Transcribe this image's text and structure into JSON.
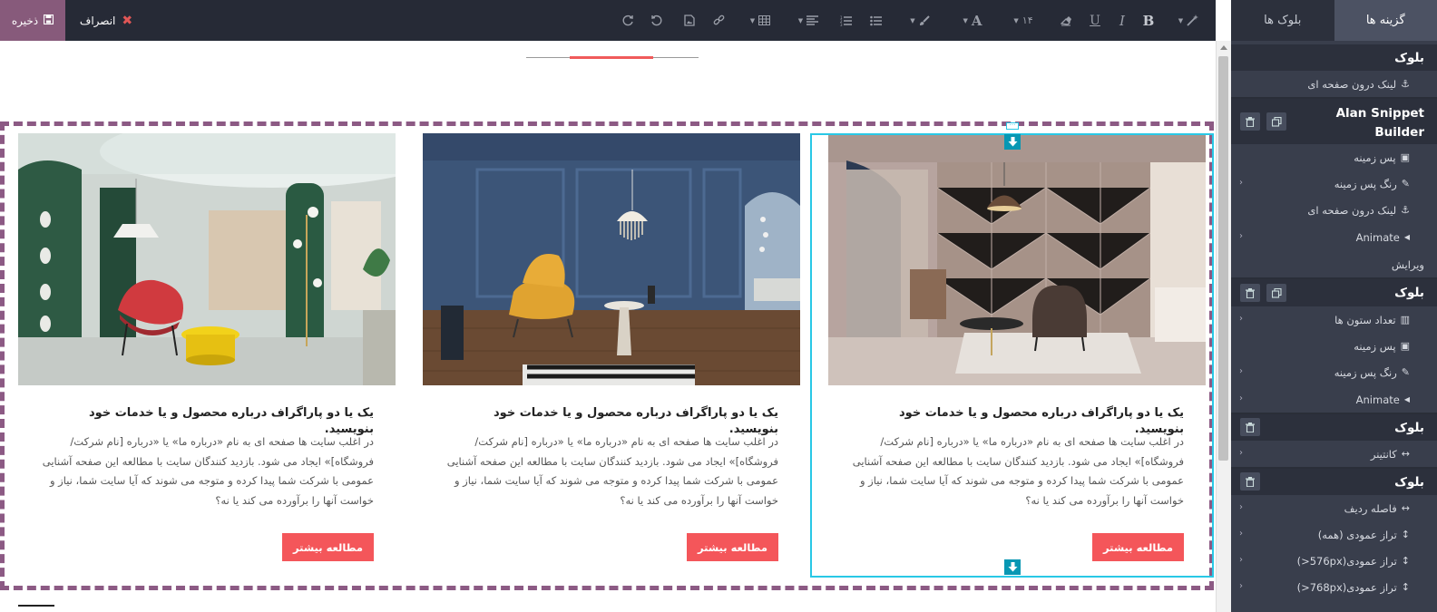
{
  "toolbar": {
    "save_label": "ذخیره",
    "discard_label": "انصراف",
    "font_size_label": "۱۴",
    "icons": [
      "magic-wand",
      "bold",
      "italic",
      "underline",
      "eraser",
      "font-size",
      "font-color",
      "paint-brush",
      "unordered-list",
      "ordered-list",
      "align",
      "table",
      "link",
      "image",
      "undo",
      "redo"
    ]
  },
  "sidebar": {
    "tabs": [
      {
        "label": "گزینه ها",
        "active": true
      },
      {
        "label": "بلوک ها",
        "active": false
      }
    ],
    "sections": {
      "s1_title": "بلوک",
      "s1_anchor": "لینک درون صفحه ای",
      "s2_title": "Alan Snippet Builder",
      "s2_background": "پس زمینه",
      "s2_bg_color": "رنگ پس زمینه",
      "s2_anchor": "لینک درون صفحه ای",
      "s2_animate": "Animate",
      "s2_edit": "ویرایش",
      "s3_title": "بلوک",
      "s3_columns": "تعداد ستون ها",
      "s3_background": "پس زمینه",
      "s3_bg_color": "رنگ پس زمینه",
      "s3_animate": "Animate",
      "s4_title": "بلوک",
      "s4_container": "کانتینر",
      "s5_title": "بلوک",
      "s5_row_gap": "فاصله ردیف",
      "s5_valign_all": "تراز عمودی (همه)",
      "s5_valign_576": "تراز عمودی(576px<)",
      "s5_valign_768": "تراز عمودی(768px<)"
    }
  },
  "cards": [
    {
      "title": "یک یا دو پاراگراف درباره محصول و یا خدمات خود بنویسید.",
      "description": "در اغلب سایت ها صفحه ای به نام «درباره ما» یا «درباره [نام شرکت/فروشگاه]» ایجاد می شود. بازدید کنندگان سایت با مطالعه این صفحه آشنایی عمومی با شرکت شما پیدا کرده و متوجه می شوند که آیا سایت شما، نیاز و خواست آنها را برآورده می کند یا نه؟",
      "button": "مطالعه بیشتر"
    },
    {
      "title": "یک یا دو پاراگراف درباره محصول و یا خدمات خود بنویسید.",
      "description": "در اغلب سایت ها صفحه ای به نام «درباره ما» یا «درباره [نام شرکت/فروشگاه]» ایجاد می شود. بازدید کنندگان سایت با مطالعه این صفحه آشنایی عمومی با شرکت شما پیدا کرده و متوجه می شوند که آیا سایت شما، نیاز و خواست آنها را برآورده می کند یا نه؟",
      "button": "مطالعه بیشتر"
    },
    {
      "title": "یک یا دو پاراگراف درباره محصول و یا خدمات خود بنویسید.",
      "description": "در اغلب سایت ها صفحه ای به نام «درباره ما» یا «درباره [نام شرکت/فروشگاه]» ایجاد می شود. بازدید کنندگان سایت با مطالعه این صفحه آشنایی عمومی با شرکت شما پیدا کرده و متوجه می شوند که آیا سایت شما، نیاز و خواست آنها را برآورده می کند یا نه؟",
      "button": "مطالعه بیشتر"
    }
  ],
  "colors": {
    "toolbar_bg": "#262a36",
    "save_bg": "#875a7b",
    "sidebar_bg": "#393e4c",
    "section_header_bg": "#2c303c",
    "accent_red": "#f4565a",
    "selection_cyan": "#29c8e6",
    "dashed_border": "#8c5a84"
  }
}
